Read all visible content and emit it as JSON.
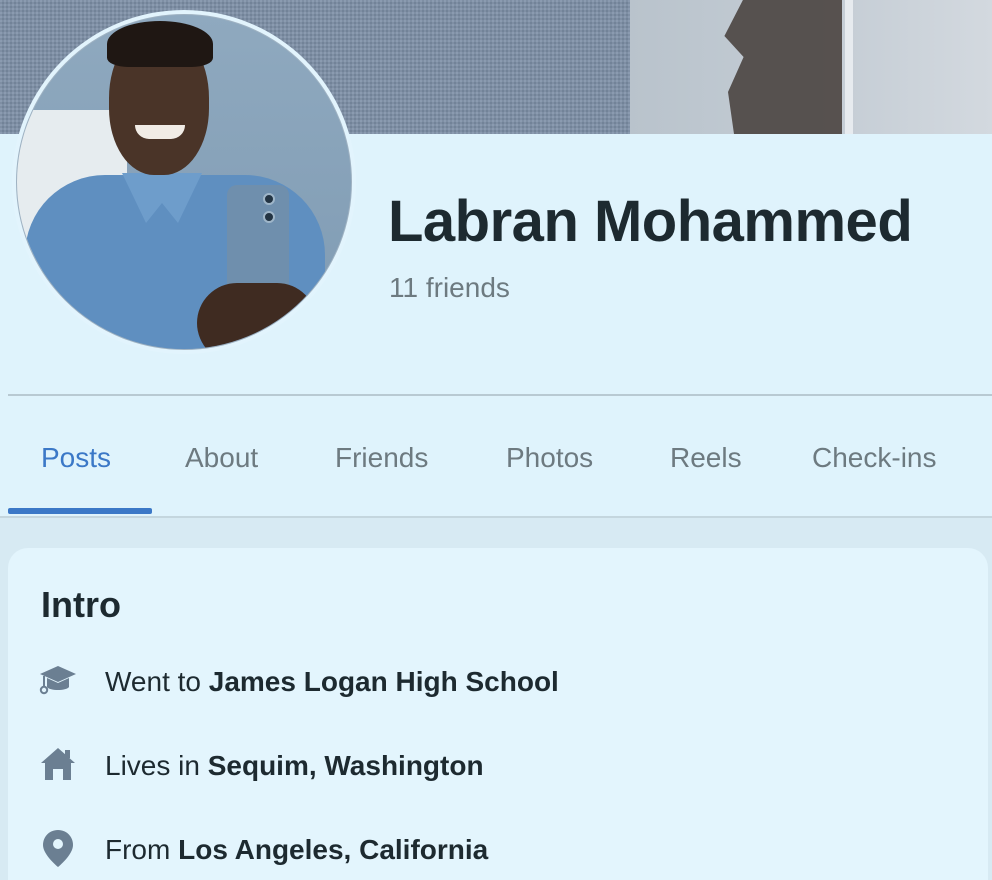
{
  "profile": {
    "name": "Labran Mohammed",
    "friends": "11 friends"
  },
  "tabs": [
    {
      "label": "Posts",
      "active": true
    },
    {
      "label": "About",
      "active": false
    },
    {
      "label": "Friends",
      "active": false
    },
    {
      "label": "Photos",
      "active": false
    },
    {
      "label": "Reels",
      "active": false
    },
    {
      "label": "Check-ins",
      "active": false
    }
  ],
  "intro": {
    "title": "Intro",
    "items": [
      {
        "icon": "graduation-cap-icon",
        "prefix": "Went to",
        "value": "James Logan High School"
      },
      {
        "icon": "home-icon",
        "prefix": "Lives in",
        "value": "Sequim, Washington"
      },
      {
        "icon": "location-pin-icon",
        "prefix": "From",
        "value": "Los Angeles, California"
      }
    ]
  },
  "colors": {
    "accent": "#3b78c7",
    "background": "#dff3fc",
    "text": "#1d2a30",
    "muted": "#6d7a80",
    "icon": "#6b7f92"
  }
}
